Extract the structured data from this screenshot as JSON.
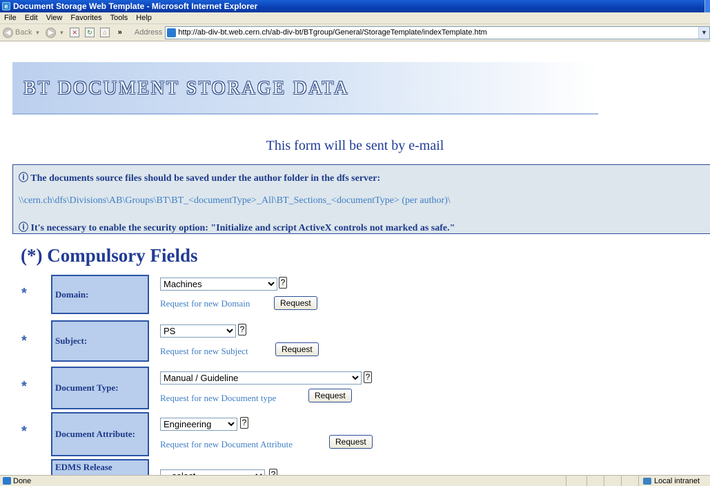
{
  "window": {
    "title": "Document Storage Web Template - Microsoft Internet Explorer"
  },
  "menu": [
    "File",
    "Edit",
    "View",
    "Favorites",
    "Tools",
    "Help"
  ],
  "toolbar": {
    "back_label": "Back",
    "chevron": "»",
    "address_label": "Address",
    "url": "http://ab-div-bt.web.cern.ch/ab-div-bt/BTgroup/General/StorageTemplate/indexTemplate.htm"
  },
  "page": {
    "banner_title": "BT DOCUMENT STORAGE DATA",
    "form_sent": "This form will be sent by e-mail",
    "info": {
      "line1": "ⓘ The documents source files should be saved under the author folder in the dfs server:",
      "path": "\\\\cern.ch\\dfs\\Divisions\\AB\\Groups\\BT\\BT_<documentType>_All\\BT_Sections_<documentType> (per author)\\",
      "line2": "ⓘ It's necessary to enable the security option: \"Initialize and script ActiveX controls not marked as safe.\""
    },
    "compulsory_heading": "(*) Compulsory Fields",
    "star": "*",
    "help": "?",
    "request_button": "Request",
    "fields": [
      {
        "label": "Domain:",
        "value": "Machines",
        "request_text": "Request for new Domain"
      },
      {
        "label": "Subject:",
        "value": "PS",
        "request_text": "Request for new Subject"
      },
      {
        "label": "Document Type:",
        "value": "Manual / Guideline",
        "request_text": "Request for new Document type"
      },
      {
        "label": "Document Attribute:",
        "value": "Engineering",
        "request_text": "Request for new Document Attribute"
      },
      {
        "label": "EDMS Release",
        "value": "-- select --",
        "request_text": ""
      }
    ]
  },
  "statusbar": {
    "text": "Done",
    "zone": "Local intranet"
  }
}
